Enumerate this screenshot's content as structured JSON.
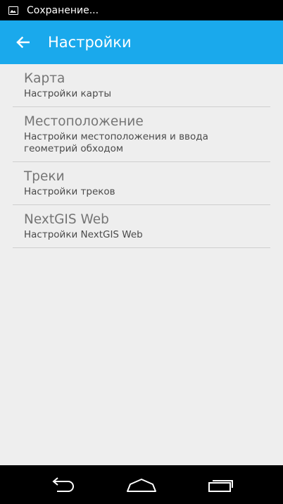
{
  "status_bar": {
    "icon": "image-icon",
    "text": "Сохранение..."
  },
  "app_bar": {
    "back_icon": "arrow-left-icon",
    "title": "Настройки",
    "color": "#1aa9ec"
  },
  "settings": [
    {
      "title": "Карта",
      "summary": "Настройки карты"
    },
    {
      "title": "Местоположение",
      "summary": "Настройки местоположения и ввода геометрий обходом"
    },
    {
      "title": "Треки",
      "summary": "Настройки треков"
    },
    {
      "title": "NextGIS Web",
      "summary": "Настройки NextGIS Web"
    }
  ],
  "nav_bar": {
    "back_icon": "nav-back-icon",
    "home_icon": "nav-home-icon",
    "recents_icon": "nav-recents-icon"
  }
}
